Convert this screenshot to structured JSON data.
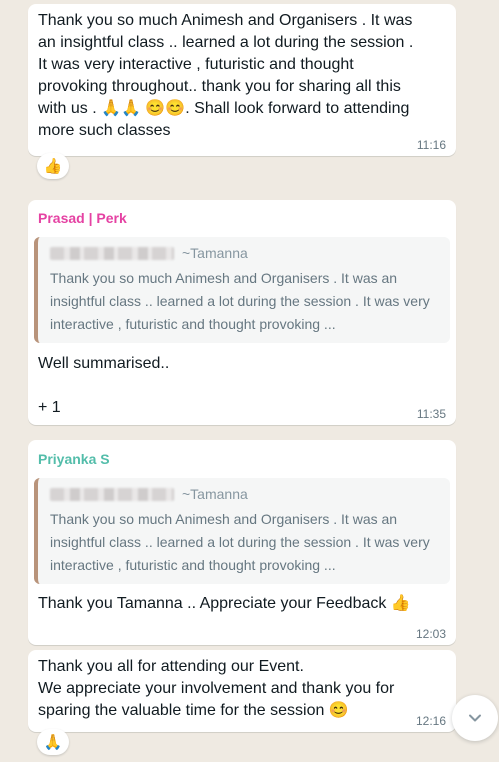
{
  "messages": [
    {
      "text": "Thank you so much Animesh and Organisers . It was\nan insightful class .. learned a lot during the session .\nIt was very interactive , futuristic and thought\nprovoking throughout.. thank you for sharing all this\nwith us . 🙏🙏 😊😊. Shall look forward to attending\nmore such classes",
      "time": "11:16",
      "reaction": "👍"
    },
    {
      "sender": "Prasad | Perk",
      "sender_color": "#e542a3",
      "quote_author": "~Tamanna",
      "quote_text": "Thank you so much Animesh and Organisers . It was an insightful class .. learned a lot during the session . It was very interactive , futuristic and thought provoking ...",
      "text": "Well summarised..",
      "extra": "+ 1",
      "time": "11:35"
    },
    {
      "sender": "Priyanka S",
      "sender_color": "#53bdaa",
      "quote_author": "~Tamanna",
      "quote_text": "Thank you so much Animesh and Organisers . It was an insightful class .. learned a lot during the session . It was very interactive , futuristic and thought provoking ...",
      "text": "Thank you Tamanna .. Appreciate your Feedback 👍",
      "time": "12:03"
    },
    {
      "text": "Thank you all for attending our Event.\nWe appreciate your involvement and thank you for\nsparing the valuable time for the session 😊",
      "time": "12:16",
      "reaction": "🙏"
    }
  ],
  "colors": {
    "background": "#efeae2",
    "bubble": "#ffffff",
    "quote_bar": "#b8937a"
  },
  "icons": {
    "scroll_down": "chevron-down-icon"
  }
}
